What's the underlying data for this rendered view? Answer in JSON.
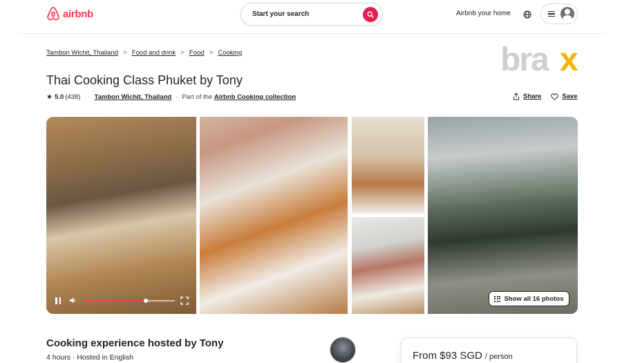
{
  "header": {
    "logo_text": "airbnb",
    "search_placeholder": "Start your search",
    "host_link": "Airbnb your home",
    "brand_color": "#ff385c",
    "icons": [
      "airbnb-logo-icon",
      "search-icon",
      "globe-icon",
      "menu-icon",
      "user-avatar-icon"
    ]
  },
  "breadcrumb": {
    "items": [
      "Tambon Wichit, Thailand",
      "Food and drink",
      "Food",
      "Cooking"
    ],
    "separator": ">"
  },
  "watermark": {
    "text": "brax"
  },
  "listing": {
    "title": "Thai Cooking Class Phuket by Tony",
    "rating": "5.0",
    "reviews": "(438)",
    "location": "Tambon Wichit, Thailand",
    "collection_prefix": "Part of the",
    "collection_name": "Airbnb Cooking collection",
    "share_label": "Share",
    "save_label": "Save"
  },
  "gallery": {
    "show_all_label": "Show all 16 photos",
    "video_progress": 0.68
  },
  "details": {
    "subtitle": "Cooking experience hosted by Tony",
    "info": "4 hours · Hosted in English"
  },
  "booking": {
    "price": "From $93 SGD",
    "per": "/ person"
  }
}
